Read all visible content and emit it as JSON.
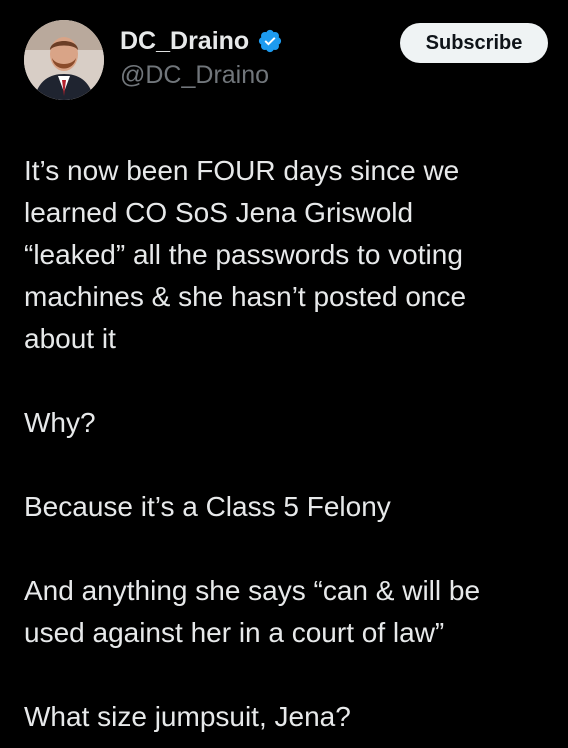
{
  "author": {
    "display_name": "DC_Draino",
    "handle": "@DC_Draino",
    "verified_icon": "verified-badge-icon",
    "avatar_icon": "profile-avatar"
  },
  "actions": {
    "subscribe_label": "Subscribe"
  },
  "tweet": {
    "paragraphs": [
      [
        "It’s now been FOUR days since we",
        "learned CO SoS Jena Griswold",
        "“leaked” all the passwords to voting",
        "machines & she hasn’t posted once",
        "about it"
      ],
      [
        "Why?"
      ],
      [
        "Because it’s a Class 5 Felony"
      ],
      [
        "And anything she says “can & will be",
        "used against her in a court of law”"
      ],
      [
        "What size jumpsuit, Jena?"
      ]
    ]
  },
  "colors": {
    "background": "#000000",
    "text": "#e7e9ea",
    "secondary_text": "#71767b",
    "verified_blue": "#1d9bf0",
    "button_bg": "#eff3f4"
  }
}
